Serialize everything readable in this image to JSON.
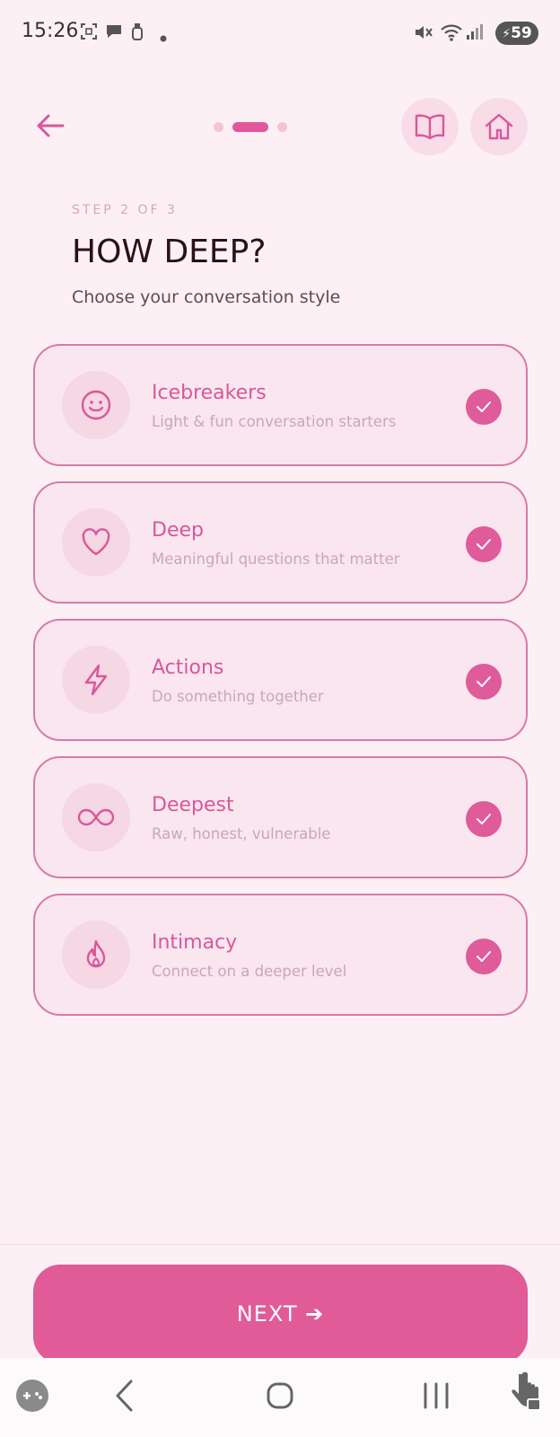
{
  "status_bar": {
    "time": "15:26",
    "battery": "59",
    "icons": [
      "screenshot-icon",
      "chat-bubble-icon",
      "bottle-icon",
      "dot-icon",
      "mute-icon",
      "wifi-icon",
      "signal-icon",
      "battery-icon"
    ]
  },
  "nav": {
    "back_icon": "arrow-left-icon",
    "steps_total": 3,
    "steps_active": 2,
    "guide_icon": "book-open-icon",
    "home_icon": "home-icon"
  },
  "header": {
    "step_label": "STEP 2 OF 3",
    "title": "HOW DEEP?",
    "subtitle": "Choose your conversation style"
  },
  "options": [
    {
      "title": "Icebreakers",
      "description": "Light & fun conversation starters",
      "icon": "smile-icon",
      "selected": true
    },
    {
      "title": "Deep",
      "description": "Meaningful questions that matter",
      "icon": "heart-icon",
      "selected": true
    },
    {
      "title": "Actions",
      "description": "Do something together",
      "icon": "lightning-icon",
      "selected": true
    },
    {
      "title": "Deepest",
      "description": "Raw, honest, vulnerable",
      "icon": "infinity-icon",
      "selected": true
    },
    {
      "title": "Intimacy",
      "description": "Connect on a deeper level",
      "icon": "flame-icon",
      "selected": true
    }
  ],
  "footer": {
    "next_label": "NEXT ➔"
  },
  "system_nav": {
    "items": [
      "gamepad-icon",
      "back-chevron-icon",
      "home-circle-icon",
      "recents-icon",
      "touch-lock-icon"
    ]
  },
  "colors": {
    "background": "#fdf0f5",
    "accent": "#e05b9a",
    "card_border": "#d97aa8",
    "card_fill": "#fae6ef"
  }
}
